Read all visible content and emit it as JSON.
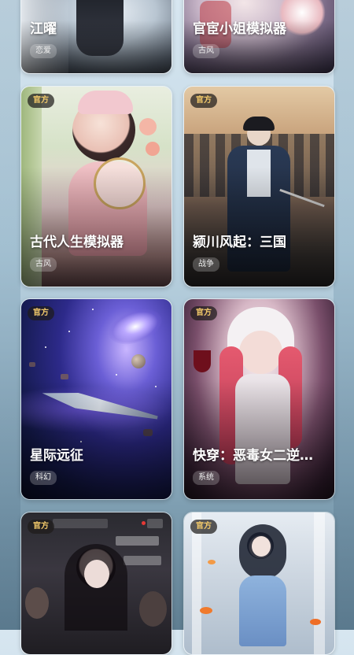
{
  "cards": [
    {
      "title": "江曜",
      "tag": "恋爱",
      "badge": ""
    },
    {
      "title": "官宦小姐模拟器",
      "tag": "古风",
      "badge": ""
    },
    {
      "title": "古代人生模拟器",
      "tag": "古风",
      "badge": "官方"
    },
    {
      "title": "颍川风起：三国",
      "tag": "战争",
      "badge": "官方"
    },
    {
      "title": "星际远征",
      "tag": "科幻",
      "badge": "官方"
    },
    {
      "title": "快穿：恶毒女二逆…",
      "tag": "系统",
      "badge": "官方"
    },
    {
      "title": "",
      "tag": "",
      "badge": "官方"
    },
    {
      "title": "",
      "tag": "",
      "badge": "官方"
    }
  ],
  "colors": {
    "badge_text": "#f2c96a",
    "title_text": "#ffffff"
  }
}
